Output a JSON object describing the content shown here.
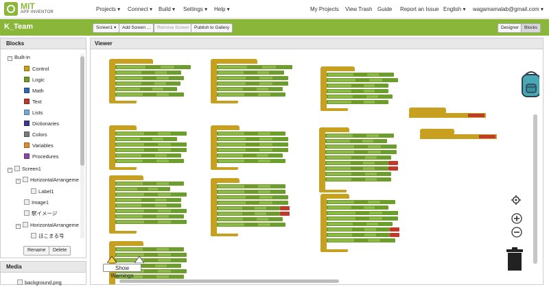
{
  "app": {
    "title_line1": "MIT",
    "title_line2": "APP INVENTOR"
  },
  "topnav": {
    "projects": "Projects ▾",
    "connect": "Connect ▾",
    "build": "Build ▾",
    "settings": "Settings ▾",
    "help": "Help ▾",
    "my_projects": "My Projects",
    "view_trash": "View Trash",
    "guide": "Guide",
    "report": "Report an Issue",
    "language": "English ▾",
    "account": "wagamamalab@gmail.com ▾"
  },
  "project": {
    "name": "K_Team",
    "screen_select": "Screen1 ▾",
    "add_screen": "Add Screen ...",
    "remove_screen": "Remove Screen",
    "publish": "Publish to Gallery",
    "designer": "Designer",
    "blocks": "Blocks"
  },
  "blocks_panel": {
    "title": "Blocks",
    "builtin": "Built-in",
    "categories": [
      {
        "label": "Control",
        "color": "#c8a020"
      },
      {
        "label": "Logic",
        "color": "#6f9b2a"
      },
      {
        "label": "Math",
        "color": "#2f65b6"
      },
      {
        "label": "Text",
        "color": "#b83a2e"
      },
      {
        "label": "Lists",
        "color": "#78a7d8"
      },
      {
        "label": "Dictionaries",
        "color": "#3a3a8a"
      },
      {
        "label": "Colors",
        "color": "#7a7a7a"
      },
      {
        "label": "Variables",
        "color": "#e08a2e"
      },
      {
        "label": "Procedures",
        "color": "#8a4a9e"
      }
    ],
    "components": [
      {
        "label": "Screen1",
        "level": 0
      },
      {
        "label": "HorizontalArrangemen",
        "level": 1
      },
      {
        "label": "Label1",
        "level": 2
      },
      {
        "label": "Image1",
        "level": 1
      },
      {
        "label": "駅イメージ",
        "level": 1
      },
      {
        "label": "HorizontalArrangemen",
        "level": 1
      },
      {
        "label": "ほこまる号",
        "level": 2
      }
    ],
    "rename": "Rename",
    "delete": "Delete"
  },
  "media_panel": {
    "title": "Media",
    "file": "background.png"
  },
  "viewer": {
    "title": "Viewer",
    "show_warnings": "Show Warnings",
    "warning_count": "0",
    "error_count": "0"
  }
}
